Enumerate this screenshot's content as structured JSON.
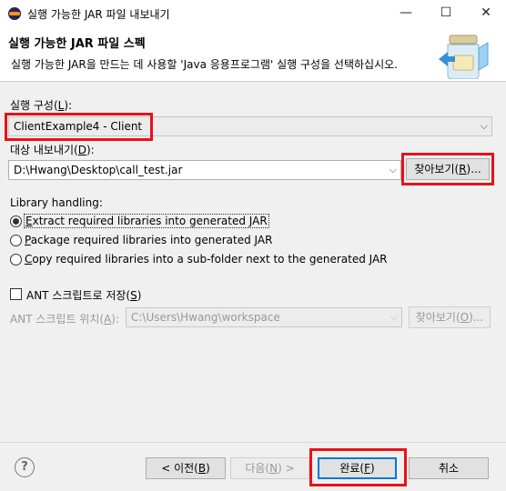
{
  "window": {
    "title": "실행 가능한 JAR 파일 내보내기",
    "minimize": "—",
    "maximize": "☐",
    "close": "✕"
  },
  "banner": {
    "title": "실행 가능한 JAR 파일 스펙",
    "description": "실행 가능한 JAR을 만드는 데 사용할 'Java 응용프로그램' 실행 구성을 선택하십시오."
  },
  "launch_config": {
    "label": "실행 구성(",
    "label_mnemonic": "L",
    "label_end": "):",
    "value": "ClientExample4 - Client"
  },
  "export_dest": {
    "label": "대상 내보내기(",
    "label_mnemonic": "D",
    "label_end": "):",
    "value": "D:\\Hwang\\Desktop\\call_test.jar",
    "browse_label": "찾아보기(",
    "browse_mnemonic": "R",
    "browse_end": ")..."
  },
  "library": {
    "heading": "Library handling:",
    "options": [
      {
        "first": "E",
        "rest": "xtract required libraries into generated JAR",
        "checked": true
      },
      {
        "first": "P",
        "rest": "ackage required libraries into generated JAR",
        "checked": false
      },
      {
        "first": "C",
        "rest": "opy required libraries into a sub-folder next to the generated JAR",
        "checked": false
      }
    ]
  },
  "ant": {
    "checkbox_label": "ANT 스크립트로 저장(",
    "checkbox_mnemonic": "S",
    "checkbox_end": ")",
    "location_label": "ANT 스크립트 위치(",
    "location_mnemonic": "A",
    "location_end": "):",
    "location_value": "C:\\Users\\Hwang\\workspace",
    "browse_label": "찾아보기(",
    "browse_mnemonic": "O",
    "browse_end": ")..."
  },
  "footer": {
    "help": "?",
    "back_label": "< 이전(",
    "back_mnemonic": "B",
    "back_end": ")",
    "next_label": "다음(",
    "next_mnemonic": "N",
    "next_end": ") >",
    "finish_label": "완료(",
    "finish_mnemonic": "F",
    "finish_end": ")",
    "cancel_label": "취소"
  },
  "colors": {
    "highlight": "#e8121a",
    "primary_border": "#0078d7"
  }
}
